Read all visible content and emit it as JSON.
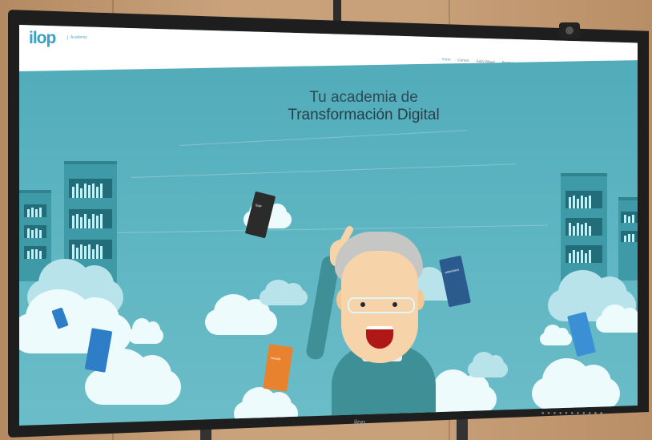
{
  "site": {
    "logo_text": "ilop",
    "logo_subtitle": "Academy"
  },
  "nav": {
    "items": [
      {
        "label": "Inicio",
        "active": true
      },
      {
        "label": "Cursos",
        "active": false
      },
      {
        "label": "Aula Virtual",
        "active": false
      },
      {
        "label": "Partners",
        "active": false
      },
      {
        "label": "Bolsa de empleo",
        "active": false
      },
      {
        "label": "Blog",
        "active": false
      },
      {
        "label": "Contacto",
        "active": false
      },
      {
        "label": "Acceder",
        "active": false
      }
    ],
    "search_icon": "search-icon"
  },
  "hero": {
    "title_line1": "Tu academia de",
    "title_line2": "Transformación Digital"
  },
  "books": [
    {
      "name": "book-sap",
      "label": "SAP",
      "color": "#2b2b2b"
    },
    {
      "name": "book-salesforce",
      "label": "salesforce",
      "color": "#2a5a8e"
    },
    {
      "name": "book-moodle",
      "label": "moodle",
      "color": "#e9822e"
    },
    {
      "name": "book-left",
      "label": "",
      "color": "#2e7dc7"
    },
    {
      "name": "book-right",
      "label": "",
      "color": "#3b8fd4"
    }
  ],
  "monitor": {
    "brand": "ilop"
  },
  "colors": {
    "accent": "#3aa0c4",
    "background": "#5cb4c1",
    "title_text": "#2e4a55"
  }
}
